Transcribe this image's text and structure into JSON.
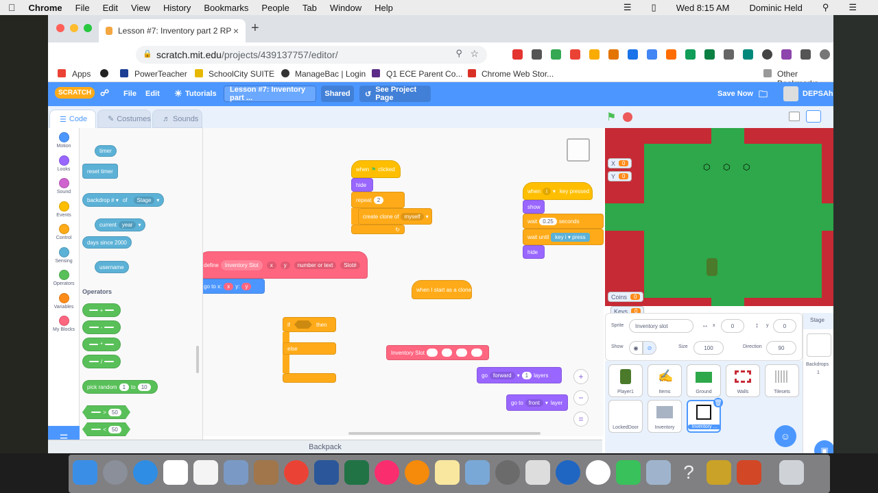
{
  "menubar": {
    "app": "Chrome",
    "items": [
      "File",
      "Edit",
      "View",
      "History",
      "Bookmarks",
      "People",
      "Tab",
      "Window",
      "Help"
    ],
    "clock": "Wed 8:15 AM",
    "user": "Dominic Held"
  },
  "browser": {
    "tab_title": "Lesson #7: Inventory part 2 RP",
    "url_host": "scratch.mit.edu",
    "url_path": "/projects/439137757/editor/",
    "bookmarks": [
      "Apps",
      "PowerTeacher",
      "SchoolCity SUITE",
      "ManageBac | Login",
      "Q1 ECE Parent Co...",
      "Chrome Web Stor...",
      "Other Bookmarks"
    ]
  },
  "scratch_menu": {
    "logo": "SCRATCH",
    "file": "File",
    "edit": "Edit",
    "tutorials": "Tutorials",
    "project_title": "Lesson #7: Inventory part ...",
    "shared": "Shared",
    "see_project": "See Project Page",
    "save_now": "Save Now",
    "username": "DEPSAheld"
  },
  "editor_tabs": [
    "Code",
    "Costumes",
    "Sounds"
  ],
  "categories": [
    {
      "label": "Motion",
      "color": "#4c97ff"
    },
    {
      "label": "Looks",
      "color": "#9966ff"
    },
    {
      "label": "Sound",
      "color": "#cf63cf"
    },
    {
      "label": "Events",
      "color": "#ffbf00"
    },
    {
      "label": "Control",
      "color": "#ffab19"
    },
    {
      "label": "Sensing",
      "color": "#5cb1d6"
    },
    {
      "label": "Operators",
      "color": "#59c059"
    },
    {
      "label": "Variables",
      "color": "#ff8c1a"
    },
    {
      "label": "My Blocks",
      "color": "#ff6680"
    }
  ],
  "palette": {
    "timer": "timer",
    "reset_timer": "reset timer",
    "backdrop": "backdrop #",
    "of": "of",
    "stage": "Stage",
    "current": "current",
    "year": "year",
    "days_since": "days since 2000",
    "username": "username",
    "operators_heading": "Operators",
    "op_plus": "+",
    "op_minus": "-",
    "op_times": "*",
    "op_div": "/",
    "pick_random": "pick random",
    "pick_to": "to",
    "pick_a": "1",
    "pick_b": "10",
    "gt": ">",
    "lt": "<",
    "eq": "=",
    "fifty": "50"
  },
  "workspace": {
    "when_flag_a": "when",
    "when_flag_b": "clicked",
    "hide": "hide",
    "repeat": "repeat",
    "repeat_n": "2",
    "create_clone": "create clone of",
    "myself": "myself",
    "when_key_a": "when",
    "when_key_i": "i",
    "when_key_b": "key pressed",
    "show": "show",
    "wait": "wait",
    "wait_n": "0.25",
    "seconds": "seconds",
    "wait_until": "wait until",
    "key": "key",
    "key_i": "i",
    "pressed": "press",
    "hide2": "hide",
    "define": "define",
    "inv_slot": "Inventory Slot",
    "x": "x",
    "y": "y",
    "number_or_text": "number or text",
    "slot_hash": "Slot#",
    "go_to_x": "go to x:",
    "y_colon": "y:",
    "when_clone": "when I start as a clone",
    "if": "if",
    "then": "then",
    "else": "else",
    "inv_slot2": "Inventory Slot",
    "go": "go",
    "forward": "forward",
    "one": "1",
    "layers": "layers",
    "go_to": "go to",
    "front": "front",
    "layer": "layer",
    "backpack": "Backpack"
  },
  "stage": {
    "x_label": "X",
    "x_val": "0",
    "y_label": "Y",
    "y_val": "0",
    "coins_label": "Coins",
    "coins_val": "0",
    "keys_label": "Keys",
    "keys_val": "0"
  },
  "sprite_info": {
    "sprite_label": "Sprite",
    "sprite_name": "Inventory slot",
    "x_label": "x",
    "x_val": "0",
    "y_label": "y",
    "y_val": "0",
    "show_label": "Show",
    "size_label": "Size",
    "size_val": "100",
    "direction_label": "Direction",
    "direction_val": "90"
  },
  "sprites": [
    "Player1",
    "Items",
    "Ground",
    "Walls",
    "Tilesets",
    "LockedDoor",
    "Inventory",
    "Inventory ..."
  ],
  "stage_panel": {
    "label": "Stage",
    "backdrops": "Backdrops",
    "count": "1"
  }
}
